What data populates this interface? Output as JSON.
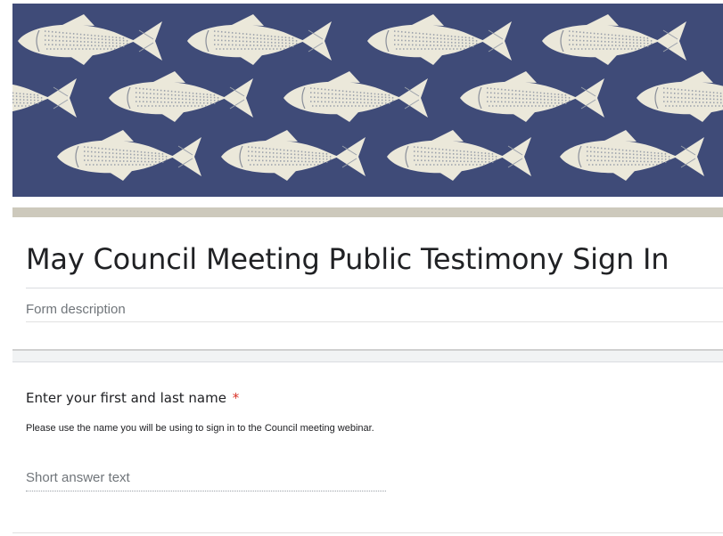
{
  "header": {
    "banner_background": "#3f4b78",
    "fish_color": "#ebe8da",
    "strip_color": "#cdc9bc"
  },
  "form": {
    "title": "May Council Meeting Public Testimony Sign In",
    "description_placeholder": "Form description"
  },
  "question": {
    "title": "Enter your first and last name",
    "required_mark": "*",
    "help_text": "Please use the name you will be using to sign in to the Council meeting webinar.",
    "answer_placeholder": "Short answer text"
  },
  "colors": {
    "required": "#d93025",
    "title_text": "#202124",
    "placeholder_text": "#70757a"
  }
}
